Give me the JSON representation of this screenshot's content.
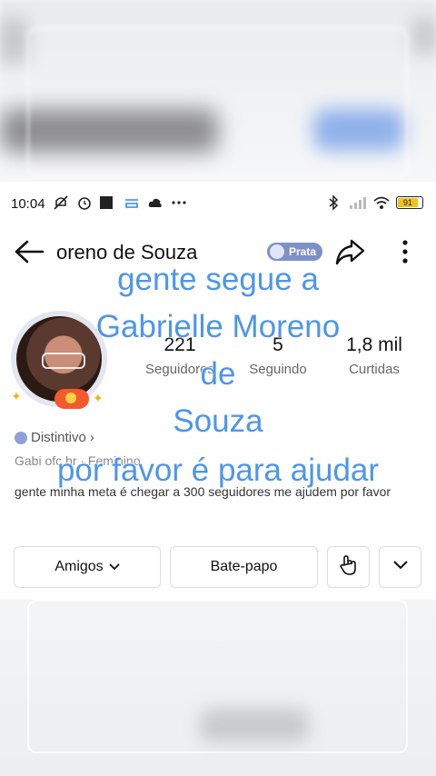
{
  "status_bar": {
    "time": "10:04",
    "battery": "91"
  },
  "header": {
    "title": "oreno de Souza",
    "badge": "Prata"
  },
  "stats": [
    {
      "value": "221",
      "label": "Seguidores"
    },
    {
      "value": "5",
      "label": "Seguindo"
    },
    {
      "value": "1,8 mil",
      "label": "Curtidas"
    }
  ],
  "profile": {
    "distintivo": "Distintivo",
    "subline": "Gabi ofc br · Feminino",
    "bio": "gente minha meta é chegar a 300 seguidores me ajudem por favor"
  },
  "actions": {
    "friends_label": "Amigos",
    "chat_label": "Bate-papo"
  },
  "overlay": {
    "line1": "gente segue a",
    "line2": "Gabrielle Moreno",
    "line3": "de",
    "line4": "Souza",
    "line5": "por favor é para ajudar"
  },
  "colors": {
    "overlay_text": "#4d96ea",
    "badge": "#7e90c9"
  }
}
